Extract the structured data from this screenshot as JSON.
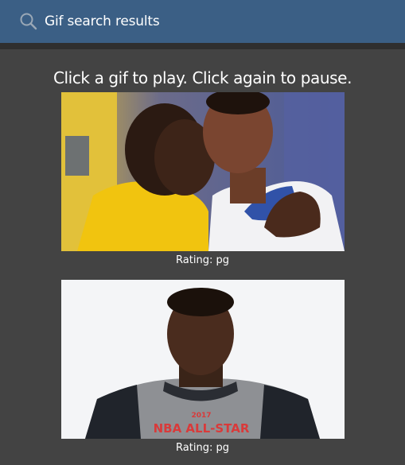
{
  "header": {
    "title": "Gif search results",
    "icon": "search-icon"
  },
  "main": {
    "instructions": "Click a gif to play. Click again to pause.",
    "results": [
      {
        "rating_label": "Rating: pg",
        "description": "Two basketball players in yellow and white Warriors jerseys, one whispering to the other"
      },
      {
        "rating_label": "Rating: pg",
        "description": "Basketball player portrait wearing grey 2017 NBA All-Star shirt",
        "shirt_text": "2017 NBA ALL-STAR"
      }
    ]
  },
  "colors": {
    "header_bg": "#3b5f85",
    "page_bg": "#434343",
    "text": "#ffffff"
  }
}
